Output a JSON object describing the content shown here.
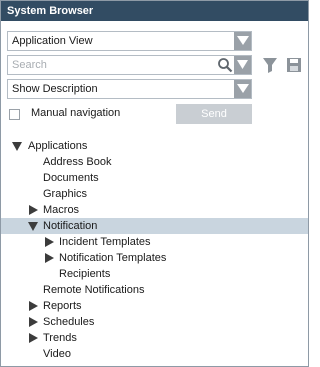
{
  "window": {
    "title": "System Browser"
  },
  "view_select": {
    "value": "Application View"
  },
  "search": {
    "placeholder": "Search",
    "value": ""
  },
  "description_select": {
    "value": "Show Description"
  },
  "manual_navigation": {
    "label": "Manual navigation",
    "checked": false
  },
  "send_button": {
    "label": "Send",
    "enabled": false
  },
  "tree": {
    "applications": "Applications",
    "address_book": "Address Book",
    "documents": "Documents",
    "graphics": "Graphics",
    "macros": "Macros",
    "notification": "Notification",
    "incident_templates": "Incident Templates",
    "notification_templates": "Notification Templates",
    "recipients": "Recipients",
    "remote_notifications": "Remote Notifications",
    "reports": "Reports",
    "schedules": "Schedules",
    "trends": "Trends",
    "video": "Video"
  },
  "colors": {
    "titlebar": "#324c63",
    "selection": "#c9d5df",
    "dropdown_arrow": "#9aa1a8",
    "disabled_button": "#c9ced3"
  }
}
